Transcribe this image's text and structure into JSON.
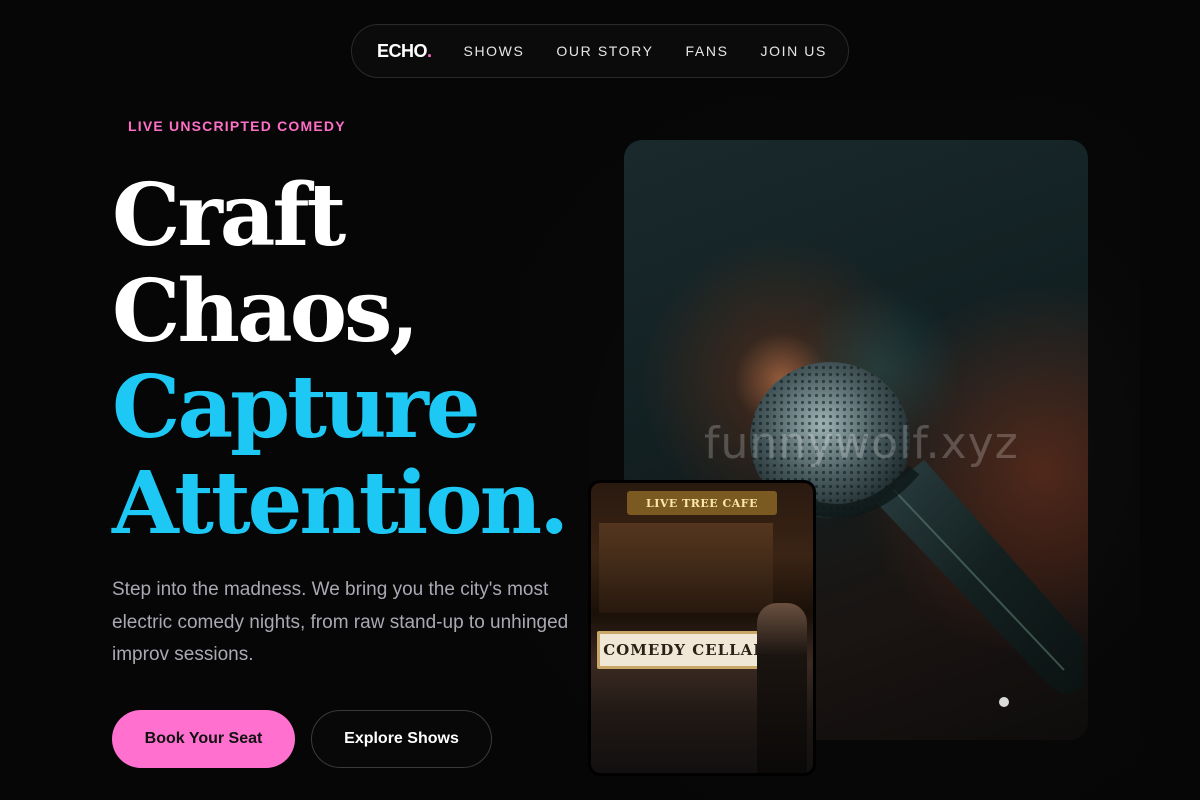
{
  "nav": {
    "logo": "ECHO",
    "logo_dot": ".",
    "links": [
      "SHOWS",
      "OUR STORY",
      "FANS",
      "JOIN US"
    ]
  },
  "hero": {
    "eyebrow": "LIVE UNSCRIPTED COMEDY",
    "headline_lines": [
      "Craft",
      "Chaos,",
      "Capture",
      "Attention."
    ],
    "lede": "Step into the madness. We bring you the city's most electric comedy nights, from raw stand-up to unhinged improv sessions.",
    "primary_button": "Book Your Seat",
    "secondary_button": "Explore Shows"
  },
  "images": {
    "mic_watermark": "funnywolf.xyz",
    "club_sign_top": "LIVE TREE CAFE",
    "club_marquee": "COMEDY CELLAR"
  },
  "colors": {
    "accent_pink": "#ff70cf",
    "accent_cyan": "#1ec8f5",
    "background": "#060606"
  }
}
